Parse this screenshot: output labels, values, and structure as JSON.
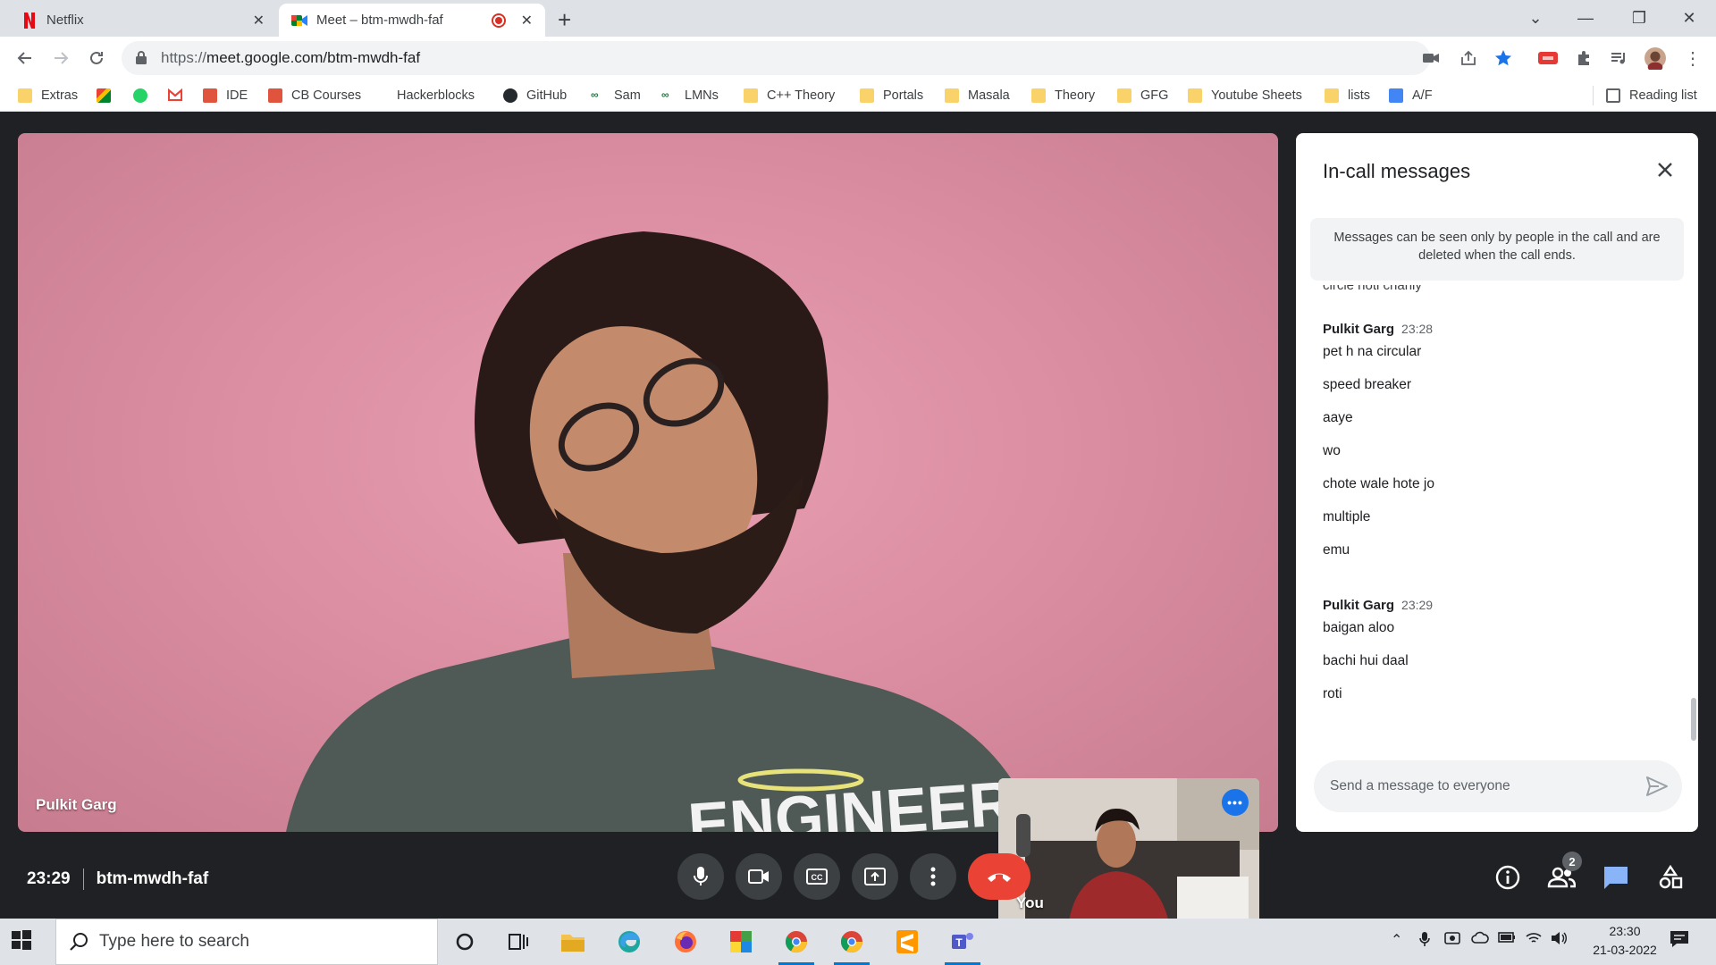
{
  "browser": {
    "tabs": [
      {
        "title": "Netflix",
        "active": false
      },
      {
        "title": "Meet – btm-mwdh-faf",
        "active": true
      }
    ],
    "url_scheme": "https://",
    "url_host": "meet.google.com/btm-mwdh-faf",
    "bookmarks": [
      "Extras",
      "IDE",
      "CB Courses",
      "Hackerblocks",
      "GitHub",
      "Sam",
      "LMNs",
      "C++ Theory",
      "Portals",
      "Masala",
      "Theory",
      "GFG",
      "Youtube Sheets",
      "lists",
      "A/F"
    ],
    "reading_list": "Reading list"
  },
  "meet": {
    "main_participant": "Pulkit Garg",
    "self_label": "You",
    "time": "23:29",
    "meeting_code": "btm-mwdh-faf",
    "participant_count": "2"
  },
  "chat": {
    "title": "In-call messages",
    "notice": "Messages can be seen only by people in the call and are deleted when the call ends.",
    "cut_line": "circle hoti chahiy",
    "groups": [
      {
        "sender": "Pulkit Garg",
        "time": "23:28",
        "lines": [
          "pet h na circular",
          "speed breaker",
          "aaye",
          "wo",
          "chote wale hote jo",
          "multiple",
          "emu"
        ]
      },
      {
        "sender": "Pulkit Garg",
        "time": "23:29",
        "lines": [
          "baigan aloo",
          "bachi hui daal",
          "roti"
        ]
      }
    ],
    "placeholder": "Send a message to everyone"
  },
  "taskbar": {
    "search_placeholder": "Type here to search",
    "clock_time": "23:30",
    "clock_date": "21-03-2022"
  },
  "colors": {
    "meet_bg": "#202124",
    "end_call": "#ea4335",
    "accent": "#1a73e8",
    "wall_pink": "#dc8ea2"
  }
}
